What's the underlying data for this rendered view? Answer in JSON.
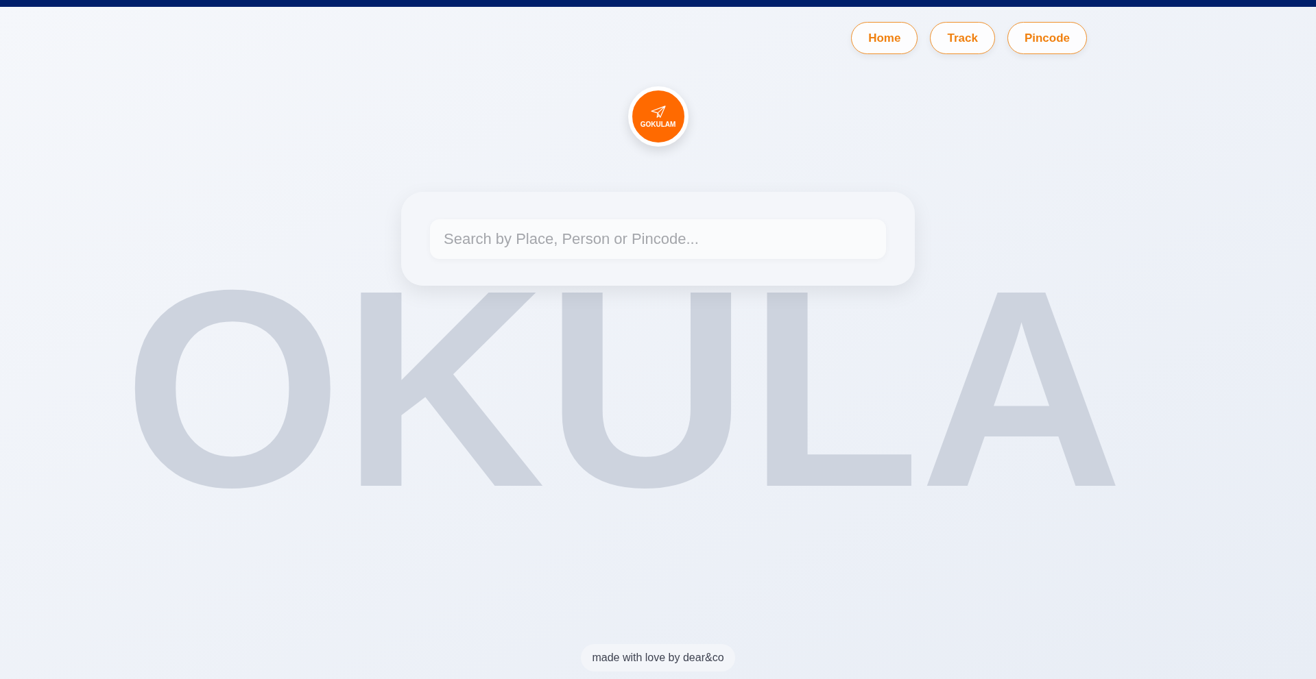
{
  "nav": [
    {
      "label": "Home"
    },
    {
      "label": "Track"
    },
    {
      "label": "Pincode"
    }
  ],
  "logo": {
    "label": "GOKULAM"
  },
  "background_word": "OKULA",
  "search": {
    "placeholder": "Search by Place, Person or Pincode..."
  },
  "footer": "made with love by dear&co"
}
